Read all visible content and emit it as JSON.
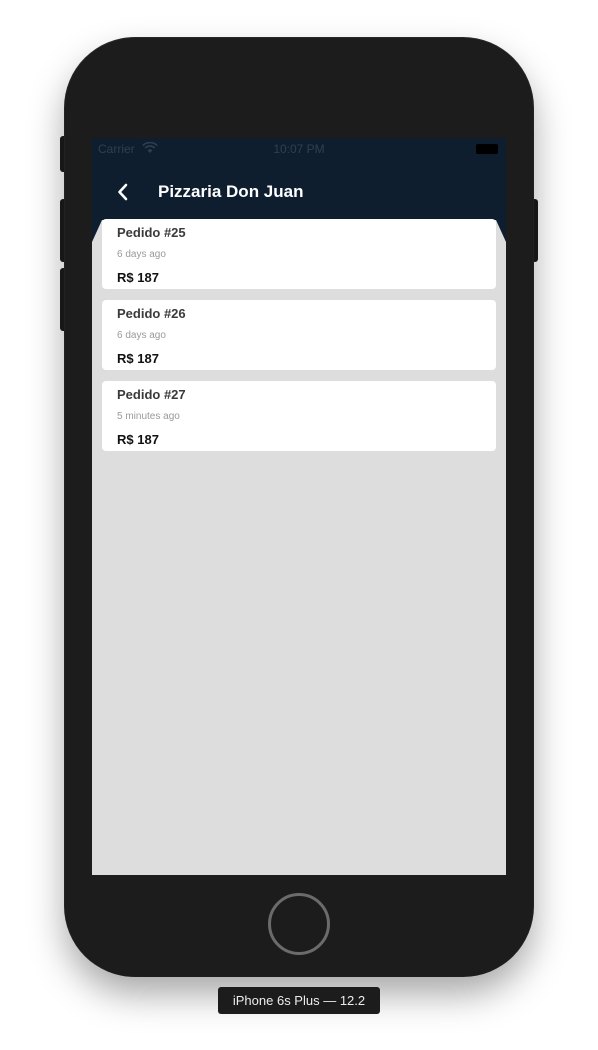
{
  "status_bar": {
    "carrier": "Carrier",
    "time": "10:07 PM"
  },
  "nav": {
    "title": "Pizzaria Don Juan",
    "back_icon": "chevron-left-icon"
  },
  "orders": [
    {
      "title": "Pedido #25",
      "time": "6 days ago",
      "price": "R$ 187"
    },
    {
      "title": "Pedido #26",
      "time": "6 days ago",
      "price": "R$ 187"
    },
    {
      "title": "Pedido #27",
      "time": "5 minutes ago",
      "price": "R$ 187"
    }
  ],
  "device_label": "iPhone 6s Plus — 12.2",
  "colors": {
    "header": "#0f1e2e",
    "background": "#dddddd",
    "card": "#ffffff"
  }
}
